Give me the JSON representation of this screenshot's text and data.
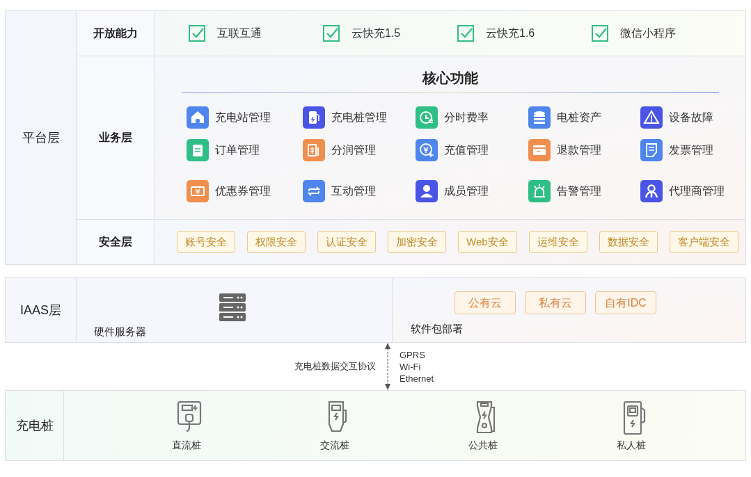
{
  "platform": {
    "label": "平台层",
    "open": {
      "label": "开放能力",
      "items": [
        {
          "label": "互联互通",
          "checked": true
        },
        {
          "label": "云快充1.5",
          "checked": true
        },
        {
          "label": "云快充1.6",
          "checked": true
        },
        {
          "label": "微信小程序",
          "checked": true
        }
      ]
    },
    "business": {
      "label": "业务层",
      "title": "核心功能",
      "features": [
        {
          "label": "充电站管理",
          "color": "#4f86ee"
        },
        {
          "label": "充电桩管理",
          "color": "#4a55e6"
        },
        {
          "label": "分时费率",
          "color": "#2fbf86"
        },
        {
          "label": "电桩资产",
          "color": "#4f86ee"
        },
        {
          "label": "设备故障",
          "color": "#4a55e6"
        },
        {
          "label": "订单管理",
          "color": "#2fbf86"
        },
        {
          "label": "分润管理",
          "color": "#f08f4d"
        },
        {
          "label": "充值管理",
          "color": "#4f86ee"
        },
        {
          "label": "退款管理",
          "color": "#f08f4d"
        },
        {
          "label": "发票管理",
          "color": "#4f86ee"
        },
        {
          "label": "优惠券管理",
          "color": "#f08f4d"
        },
        {
          "label": "互动管理",
          "color": "#4f86ee"
        },
        {
          "label": "成员管理",
          "color": "#4a55e6"
        },
        {
          "label": "告警管理",
          "color": "#2fbf86"
        },
        {
          "label": "代理商管理",
          "color": "#4a55e6"
        }
      ]
    },
    "security": {
      "label": "安全层",
      "tags": [
        "账号安全",
        "权限安全",
        "认证安全",
        "加密安全",
        "Web安全",
        "运维安全",
        "数据安全",
        "客户端安全"
      ]
    }
  },
  "iaas": {
    "label": "IAAS层",
    "hardware": {
      "label": "硬件服务器"
    },
    "software": {
      "label": "软件包部署",
      "options": [
        "公有云",
        "私有云",
        "自有IDC"
      ]
    }
  },
  "protocol": {
    "label": "充电桩数据交互协议",
    "lines": [
      "GPRS",
      "Wi-Fi",
      "Ethernet"
    ]
  },
  "chargers": {
    "label": "充电桩",
    "items": [
      {
        "label": "直流桩"
      },
      {
        "label": "交流桩"
      },
      {
        "label": "公共桩"
      },
      {
        "label": "私人桩"
      }
    ]
  }
}
